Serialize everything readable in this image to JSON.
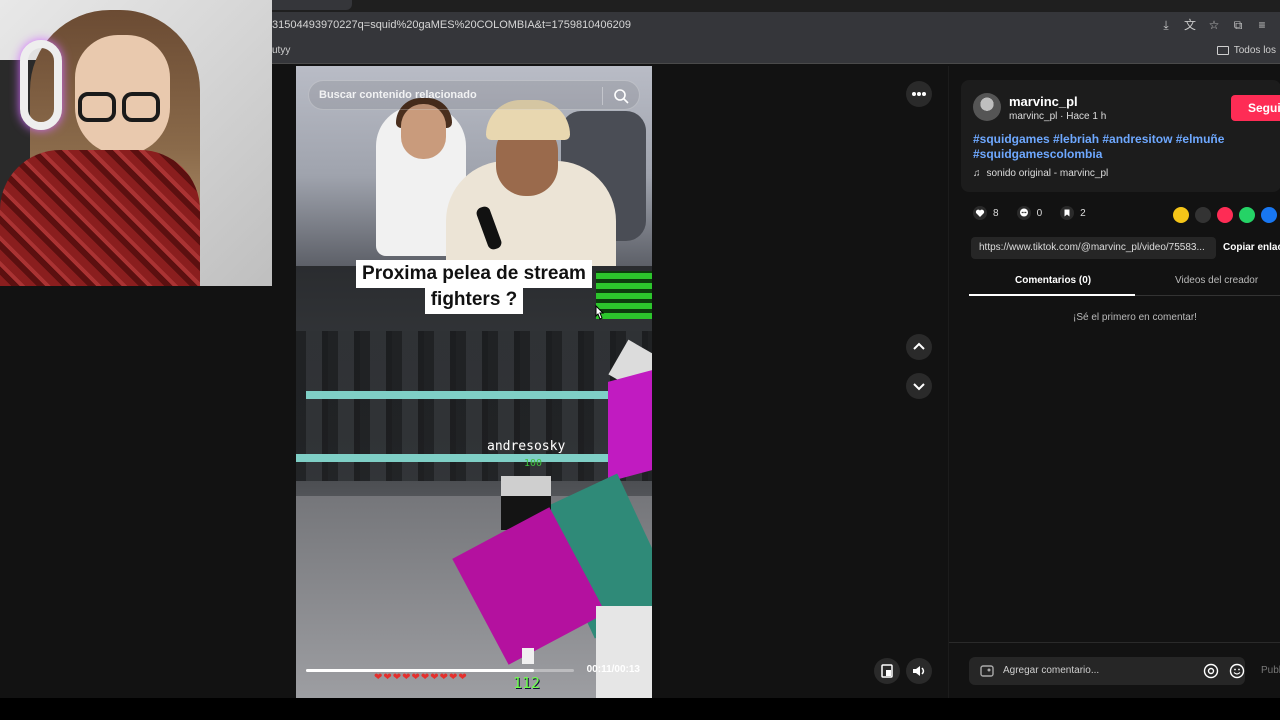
{
  "browser": {
    "url": "31504493970227q=squid%20gaMES%20COLOMBIA&t=1759810406209",
    "bookmark_left": "utyy",
    "bookmark_right": "Todos los"
  },
  "video": {
    "search_placeholder": "Buscar contenido relacionado",
    "caption_line1": "Proxima pelea de stream",
    "caption_line2": "fighters ?",
    "game_nametag": "andresosky",
    "game_hp": "100",
    "hud_level": "112",
    "hud_hearts": "❤❤❤❤❤❤❤❤❤❤",
    "time": "00:11/00:13",
    "progress": 0.85
  },
  "post": {
    "username": "marvinc_pl",
    "subname": "marvinc_pl · Hace 1 h",
    "follow_label": "Seguir",
    "hashtags": "#squidgames #lebriah #andresitow #elmuñe #squidgamescolombia",
    "sound": "sonido original - marvinc_pl",
    "likes": "8",
    "comments": "0",
    "saves": "2",
    "link": "https://www.tiktok.com/@marvinc_pl/video/75583...",
    "copy_label": "Copiar enlace",
    "tab_comments": "Comentarios (0)",
    "tab_videos": "Videos del creador",
    "empty_text": "¡Sé el primero en comentar!",
    "comment_placeholder": "Agregar comentario...",
    "publish_label": "Publicar"
  },
  "colors": {
    "accent": "#fe2c55",
    "hashtag": "#6ea8ff"
  }
}
